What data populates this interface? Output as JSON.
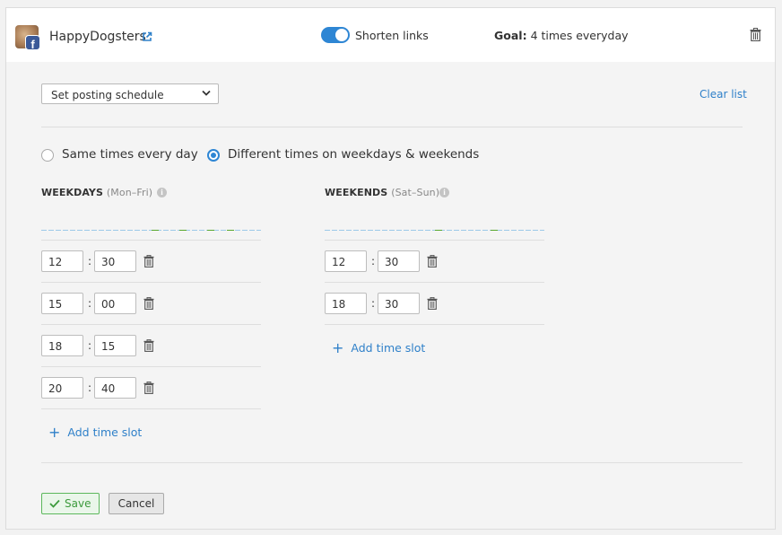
{
  "header": {
    "account_name": "HappyDogsters",
    "network_badge": "f",
    "shorten_links_label": "Shorten links",
    "shorten_links_on": true,
    "goal_label": "Goal:",
    "goal_value": "4 times everyday"
  },
  "schedule": {
    "select_value": "Set posting schedule",
    "clear_list_label": "Clear list",
    "mode_options": [
      {
        "label": "Same times every day",
        "selected": false
      },
      {
        "label": "Different times on weekdays & weekends",
        "selected": true
      }
    ],
    "weekdays": {
      "title": "WEEKDAYS",
      "subtitle": "(Mon–Fri)",
      "slots": [
        {
          "hour": "12",
          "minute": "30"
        },
        {
          "hour": "15",
          "minute": "00"
        },
        {
          "hour": "18",
          "minute": "15"
        },
        {
          "hour": "20",
          "minute": "40"
        }
      ],
      "add_label": "Add time slot"
    },
    "weekends": {
      "title": "WEEKENDS",
      "subtitle": "(Sat–Sun)",
      "slots": [
        {
          "hour": "12",
          "minute": "30"
        },
        {
          "hour": "18",
          "minute": "30"
        }
      ],
      "add_label": "Add time slot"
    }
  },
  "actions": {
    "save_label": "Save",
    "cancel_label": "Cancel"
  },
  "colors": {
    "accent": "#2e86d4",
    "save_green": "#5cb85c",
    "link": "#2f80c9"
  }
}
